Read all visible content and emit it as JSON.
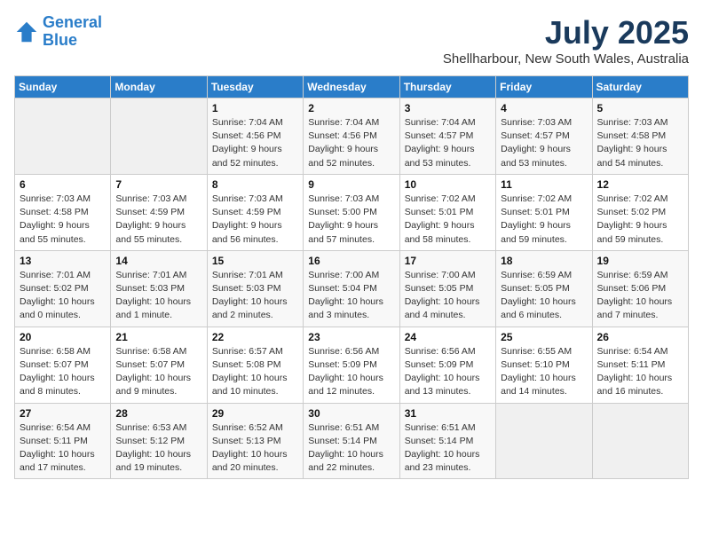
{
  "logo": {
    "line1": "General",
    "line2": "Blue"
  },
  "title": {
    "month_year": "July 2025",
    "location": "Shellharbour, New South Wales, Australia"
  },
  "days_of_week": [
    "Sunday",
    "Monday",
    "Tuesday",
    "Wednesday",
    "Thursday",
    "Friday",
    "Saturday"
  ],
  "weeks": [
    [
      {
        "day": "",
        "info": ""
      },
      {
        "day": "",
        "info": ""
      },
      {
        "day": "1",
        "info": "Sunrise: 7:04 AM\nSunset: 4:56 PM\nDaylight: 9 hours and 52 minutes."
      },
      {
        "day": "2",
        "info": "Sunrise: 7:04 AM\nSunset: 4:56 PM\nDaylight: 9 hours and 52 minutes."
      },
      {
        "day": "3",
        "info": "Sunrise: 7:04 AM\nSunset: 4:57 PM\nDaylight: 9 hours and 53 minutes."
      },
      {
        "day": "4",
        "info": "Sunrise: 7:03 AM\nSunset: 4:57 PM\nDaylight: 9 hours and 53 minutes."
      },
      {
        "day": "5",
        "info": "Sunrise: 7:03 AM\nSunset: 4:58 PM\nDaylight: 9 hours and 54 minutes."
      }
    ],
    [
      {
        "day": "6",
        "info": "Sunrise: 7:03 AM\nSunset: 4:58 PM\nDaylight: 9 hours and 55 minutes."
      },
      {
        "day": "7",
        "info": "Sunrise: 7:03 AM\nSunset: 4:59 PM\nDaylight: 9 hours and 55 minutes."
      },
      {
        "day": "8",
        "info": "Sunrise: 7:03 AM\nSunset: 4:59 PM\nDaylight: 9 hours and 56 minutes."
      },
      {
        "day": "9",
        "info": "Sunrise: 7:03 AM\nSunset: 5:00 PM\nDaylight: 9 hours and 57 minutes."
      },
      {
        "day": "10",
        "info": "Sunrise: 7:02 AM\nSunset: 5:01 PM\nDaylight: 9 hours and 58 minutes."
      },
      {
        "day": "11",
        "info": "Sunrise: 7:02 AM\nSunset: 5:01 PM\nDaylight: 9 hours and 59 minutes."
      },
      {
        "day": "12",
        "info": "Sunrise: 7:02 AM\nSunset: 5:02 PM\nDaylight: 9 hours and 59 minutes."
      }
    ],
    [
      {
        "day": "13",
        "info": "Sunrise: 7:01 AM\nSunset: 5:02 PM\nDaylight: 10 hours and 0 minutes."
      },
      {
        "day": "14",
        "info": "Sunrise: 7:01 AM\nSunset: 5:03 PM\nDaylight: 10 hours and 1 minute."
      },
      {
        "day": "15",
        "info": "Sunrise: 7:01 AM\nSunset: 5:03 PM\nDaylight: 10 hours and 2 minutes."
      },
      {
        "day": "16",
        "info": "Sunrise: 7:00 AM\nSunset: 5:04 PM\nDaylight: 10 hours and 3 minutes."
      },
      {
        "day": "17",
        "info": "Sunrise: 7:00 AM\nSunset: 5:05 PM\nDaylight: 10 hours and 4 minutes."
      },
      {
        "day": "18",
        "info": "Sunrise: 6:59 AM\nSunset: 5:05 PM\nDaylight: 10 hours and 6 minutes."
      },
      {
        "day": "19",
        "info": "Sunrise: 6:59 AM\nSunset: 5:06 PM\nDaylight: 10 hours and 7 minutes."
      }
    ],
    [
      {
        "day": "20",
        "info": "Sunrise: 6:58 AM\nSunset: 5:07 PM\nDaylight: 10 hours and 8 minutes."
      },
      {
        "day": "21",
        "info": "Sunrise: 6:58 AM\nSunset: 5:07 PM\nDaylight: 10 hours and 9 minutes."
      },
      {
        "day": "22",
        "info": "Sunrise: 6:57 AM\nSunset: 5:08 PM\nDaylight: 10 hours and 10 minutes."
      },
      {
        "day": "23",
        "info": "Sunrise: 6:56 AM\nSunset: 5:09 PM\nDaylight: 10 hours and 12 minutes."
      },
      {
        "day": "24",
        "info": "Sunrise: 6:56 AM\nSunset: 5:09 PM\nDaylight: 10 hours and 13 minutes."
      },
      {
        "day": "25",
        "info": "Sunrise: 6:55 AM\nSunset: 5:10 PM\nDaylight: 10 hours and 14 minutes."
      },
      {
        "day": "26",
        "info": "Sunrise: 6:54 AM\nSunset: 5:11 PM\nDaylight: 10 hours and 16 minutes."
      }
    ],
    [
      {
        "day": "27",
        "info": "Sunrise: 6:54 AM\nSunset: 5:11 PM\nDaylight: 10 hours and 17 minutes."
      },
      {
        "day": "28",
        "info": "Sunrise: 6:53 AM\nSunset: 5:12 PM\nDaylight: 10 hours and 19 minutes."
      },
      {
        "day": "29",
        "info": "Sunrise: 6:52 AM\nSunset: 5:13 PM\nDaylight: 10 hours and 20 minutes."
      },
      {
        "day": "30",
        "info": "Sunrise: 6:51 AM\nSunset: 5:14 PM\nDaylight: 10 hours and 22 minutes."
      },
      {
        "day": "31",
        "info": "Sunrise: 6:51 AM\nSunset: 5:14 PM\nDaylight: 10 hours and 23 minutes."
      },
      {
        "day": "",
        "info": ""
      },
      {
        "day": "",
        "info": ""
      }
    ]
  ]
}
